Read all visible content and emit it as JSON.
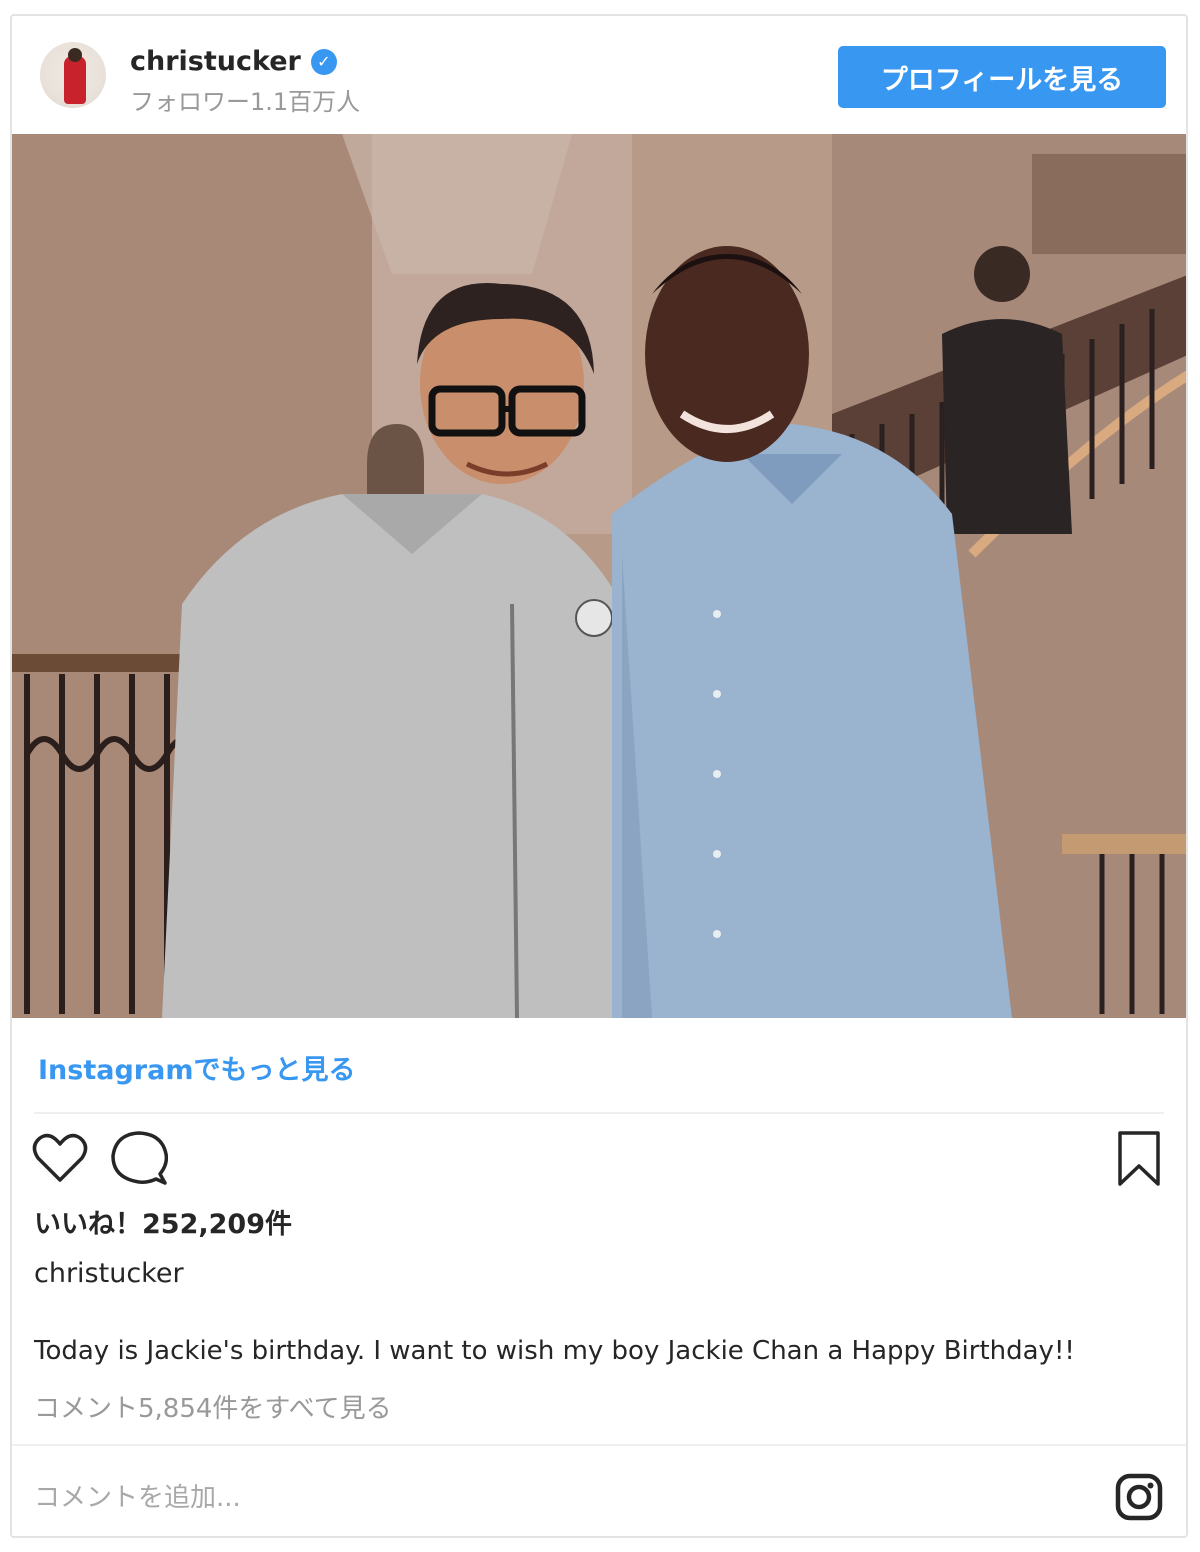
{
  "header": {
    "username": "christucker",
    "followers": "フォロワー1.1百万人",
    "profile_button": "プロフィールを見る",
    "verified_icon": "verified-badge-icon"
  },
  "photo": {
    "icon": "photo"
  },
  "more_link": "Instagramでもっと見る",
  "actions": {
    "like_icon": "heart-icon",
    "comment_icon": "comment-bubble-icon",
    "save_icon": "bookmark-icon"
  },
  "likes": "いいね！252,209件",
  "caption": {
    "username": "christucker",
    "text": "Today is Jackie's birthday. I want to wish my boy Jackie Chan a Happy Birthday!!"
  },
  "view_comments": "コメント5,854件をすべて見る",
  "add_comment_placeholder": "コメントを追加...",
  "colors": {
    "accent": "#3897f0",
    "text": "#262626",
    "muted": "#999999"
  }
}
